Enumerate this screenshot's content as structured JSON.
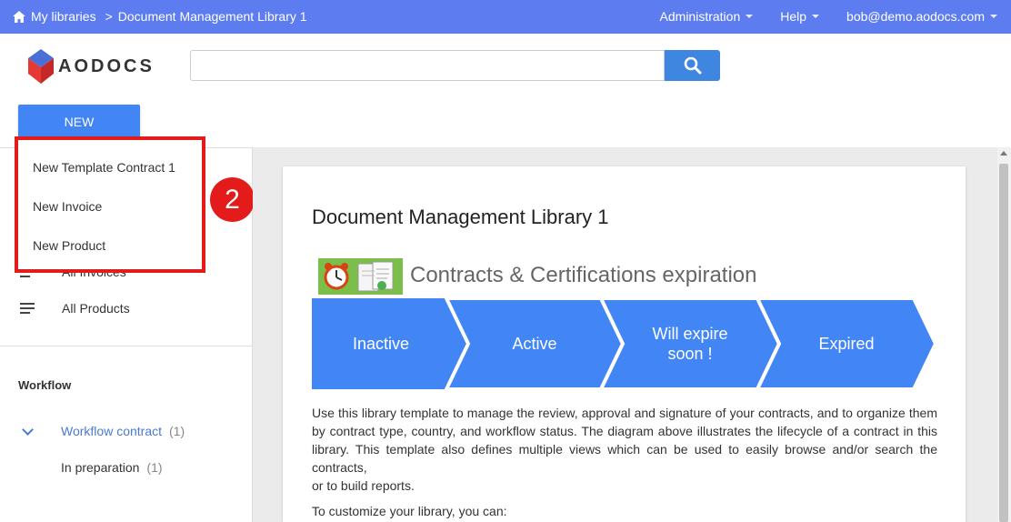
{
  "topbar": {
    "home_label": "My libraries",
    "separator": ">",
    "library_name": "Document Management Library 1",
    "nav": [
      {
        "label": "Administration"
      },
      {
        "label": "Help"
      },
      {
        "label": "bob@demo.aodocs.com"
      }
    ]
  },
  "header": {
    "logo_text": "AODOCS",
    "search_value": "",
    "search_placeholder": ""
  },
  "new_button": "NEW",
  "new_menu": {
    "items": [
      {
        "label": "New Template Contract 1"
      },
      {
        "label": "New Invoice"
      },
      {
        "label": "New Product"
      }
    ],
    "badge": "2"
  },
  "sidebar": {
    "views": [
      {
        "label": "All Invoices",
        "icon": "list-icon"
      },
      {
        "label": "All Products",
        "icon": "list-icon"
      }
    ],
    "workflow_title": "Workflow",
    "workflow_items": [
      {
        "label": "Workflow contract",
        "count": "(1)",
        "expanded": true
      },
      {
        "label": "In preparation",
        "count": "(1)"
      }
    ]
  },
  "content": {
    "title": "Document Management Library 1",
    "banner_title": "Contracts & Certifications expiration",
    "stages": [
      {
        "label": "Inactive"
      },
      {
        "label": "Active"
      },
      {
        "label": "Will expire soon !",
        "lines": [
          "Will expire",
          "soon !"
        ]
      },
      {
        "label": "Expired"
      }
    ],
    "description": "Use this library template to manage the review, approval and signature of your contracts, and to organize them by contract type, country, and workflow status. The diagram above illustrates the lifecycle of a contract in this library. This template also defines multiple views which can be used to easily browse and/or search the contracts,",
    "description_tail": "or to build reports.",
    "customize_text": "To customize your library, you can:"
  },
  "colors": {
    "topbar": "#5c7cf0",
    "primary": "#4285f4",
    "stage": "#4285f4",
    "highlight": "#e41b1b",
    "link": "#4a7bd0"
  }
}
